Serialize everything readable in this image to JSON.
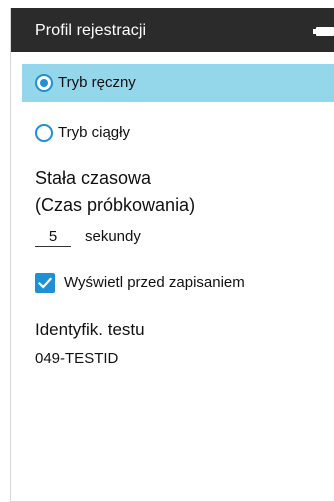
{
  "header": {
    "title": "Profil rejestracji"
  },
  "mode": {
    "options": [
      {
        "label": "Tryb ręczny",
        "selected": true
      },
      {
        "label": "Tryb ciągły",
        "selected": false
      }
    ]
  },
  "time_constant": {
    "title_line1": "Stała czasowa",
    "title_line2": "(Czas próbkowania)",
    "value": "5",
    "unit": "sekundy"
  },
  "preview": {
    "label": "Wyświetl przed zapisaniem",
    "checked": true
  },
  "test_id": {
    "title": "Identyfik. testu",
    "value": "049-TESTID"
  },
  "colors": {
    "accent": "#1e90d6",
    "selected_row": "#94d7ea",
    "titlebar": "#2b2b2b"
  },
  "icons": {
    "battery": "battery-icon",
    "checkbox_check": "checkmark-icon"
  }
}
